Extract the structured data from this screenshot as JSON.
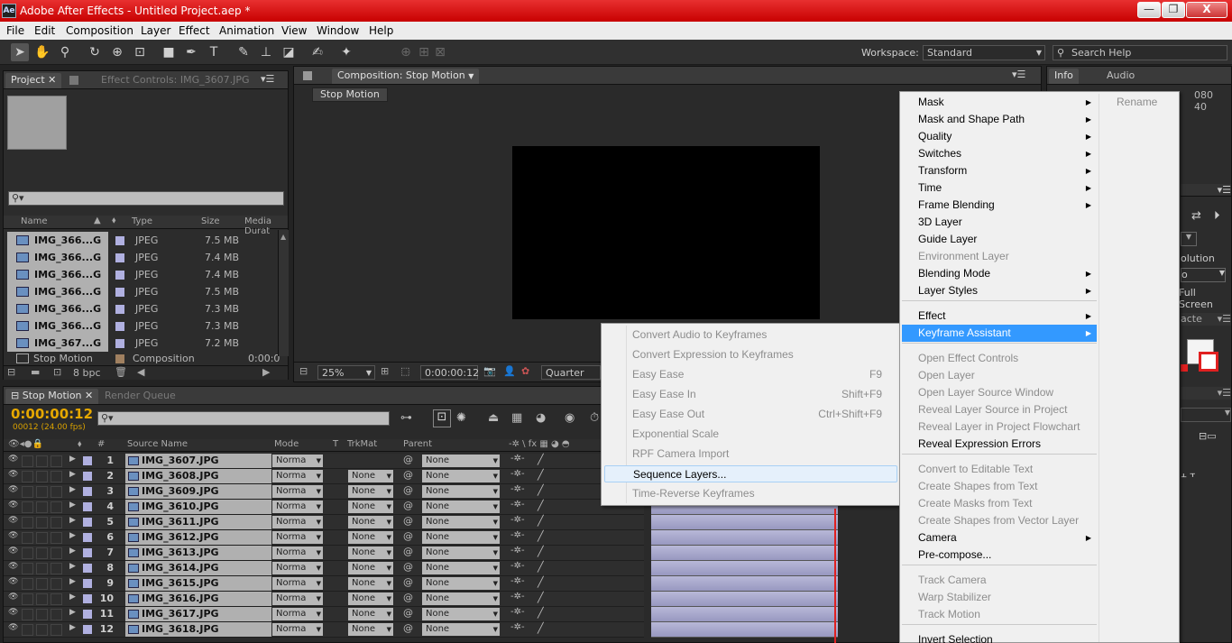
{
  "window": {
    "app_icon": "Ae",
    "title": "Adobe After Effects - Untitled Project.aep *",
    "minimize": "—",
    "maximize": "❐",
    "close": "X"
  },
  "menubar": [
    "File",
    "Edit",
    "Composition",
    "Layer",
    "Effect",
    "Animation",
    "View",
    "Window",
    "Help"
  ],
  "toolbar": {
    "workspace_label": "Workspace:",
    "workspace_value": "Standard",
    "search_placeholder": "Search Help"
  },
  "project_panel": {
    "tab_project": "Project",
    "tab_effect_controls": "Effect Controls: IMG_3607.JPG",
    "columns": {
      "name": "Name",
      "type": "Type",
      "size": "Size",
      "duration": "Media Durat"
    },
    "items": [
      {
        "name": "IMG_366...G",
        "type": "JPEG",
        "size": "7.5 MB"
      },
      {
        "name": "IMG_366...G",
        "type": "JPEG",
        "size": "7.4 MB"
      },
      {
        "name": "IMG_366...G",
        "type": "JPEG",
        "size": "7.4 MB"
      },
      {
        "name": "IMG_366...G",
        "type": "JPEG",
        "size": "7.5 MB"
      },
      {
        "name": "IMG_366...G",
        "type": "JPEG",
        "size": "7.3 MB"
      },
      {
        "name": "IMG_366...G",
        "type": "JPEG",
        "size": "7.3 MB"
      },
      {
        "name": "IMG_367...G",
        "type": "JPEG",
        "size": "7.2 MB"
      }
    ],
    "composition_item": {
      "name": "Stop Motion",
      "type": "Composition",
      "duration": "0:00:0"
    },
    "bpc": "8 bpc"
  },
  "composition_panel": {
    "tab": "Composition: Stop Motion",
    "breadcrumb": "Stop Motion",
    "zoom": "25%",
    "timecode": "0:00:00:12",
    "resolution": "Quarter"
  },
  "timeline": {
    "tab_active": "Stop Motion",
    "tab_render": "Render Queue",
    "timecode": "0:00:00:12",
    "fps": "00012 (24.00 fps)",
    "columns": {
      "num": "#",
      "source": "Source Name",
      "mode": "Mode",
      "t": "T",
      "trkmat": "TrkMat",
      "parent": "Parent"
    },
    "layers": [
      {
        "num": "1",
        "name": "IMG_3607.JPG",
        "mode": "Norma",
        "trk": "",
        "parent": "None"
      },
      {
        "num": "2",
        "name": "IMG_3608.JPG",
        "mode": "Norma",
        "trk": "None",
        "parent": "None"
      },
      {
        "num": "3",
        "name": "IMG_3609.JPG",
        "mode": "Norma",
        "trk": "None",
        "parent": "None"
      },
      {
        "num": "4",
        "name": "IMG_3610.JPG",
        "mode": "Norma",
        "trk": "None",
        "parent": "None"
      },
      {
        "num": "5",
        "name": "IMG_3611.JPG",
        "mode": "Norma",
        "trk": "None",
        "parent": "None"
      },
      {
        "num": "6",
        "name": "IMG_3612.JPG",
        "mode": "Norma",
        "trk": "None",
        "parent": "None"
      },
      {
        "num": "7",
        "name": "IMG_3613.JPG",
        "mode": "Norma",
        "trk": "None",
        "parent": "None"
      },
      {
        "num": "8",
        "name": "IMG_3614.JPG",
        "mode": "Norma",
        "trk": "None",
        "parent": "None"
      },
      {
        "num": "9",
        "name": "IMG_3615.JPG",
        "mode": "Norma",
        "trk": "None",
        "parent": "None"
      },
      {
        "num": "10",
        "name": "IMG_3616.JPG",
        "mode": "Norma",
        "trk": "None",
        "parent": "None"
      },
      {
        "num": "11",
        "name": "IMG_3617.JPG",
        "mode": "Norma",
        "trk": "None",
        "parent": "None"
      },
      {
        "num": "12",
        "name": "IMG_3618.JPG",
        "mode": "Norma",
        "trk": "None",
        "parent": "None"
      }
    ]
  },
  "right_panel": {
    "tab_info": "Info",
    "tab_audio": "Audio",
    "info_1": "080",
    "info_2": "40",
    "resolution_text": "olution",
    "full_screen": "Full Screen",
    "p_text": "o",
    "acte": "acte"
  },
  "context_menu": {
    "items": [
      {
        "label": "Mask",
        "submenu": true
      },
      {
        "label": "Mask and Shape Path",
        "submenu": true
      },
      {
        "label": "Quality",
        "submenu": true
      },
      {
        "label": "Switches",
        "submenu": true
      },
      {
        "label": "Transform",
        "submenu": true
      },
      {
        "label": "Time",
        "submenu": true
      },
      {
        "label": "Frame Blending",
        "submenu": true
      },
      {
        "label": "3D Layer"
      },
      {
        "label": "Guide Layer"
      },
      {
        "label": "Environment Layer",
        "disabled": true
      },
      {
        "label": "Blending Mode",
        "submenu": true
      },
      {
        "label": "Layer Styles",
        "submenu": true
      },
      {
        "label": "Effect",
        "submenu": true
      },
      {
        "label": "Keyframe Assistant",
        "submenu": true,
        "highlighted": true
      },
      {
        "label": "Open Effect Controls",
        "disabled": true
      },
      {
        "label": "Open Layer",
        "disabled": true
      },
      {
        "label": "Open Layer Source Window",
        "disabled": true
      },
      {
        "label": "Reveal Layer Source in Project",
        "disabled": true
      },
      {
        "label": "Reveal Layer in Project Flowchart",
        "disabled": true
      },
      {
        "label": "Reveal Expression Errors"
      },
      {
        "label": "Convert to Editable Text",
        "disabled": true
      },
      {
        "label": "Create Shapes from Text",
        "disabled": true
      },
      {
        "label": "Create Masks from Text",
        "disabled": true
      },
      {
        "label": "Create Shapes from Vector Layer",
        "disabled": true
      },
      {
        "label": "Camera",
        "submenu": true
      },
      {
        "label": "Pre-compose..."
      },
      {
        "label": "Track Camera",
        "disabled": true
      },
      {
        "label": "Warp Stabilizer",
        "disabled": true
      },
      {
        "label": "Track Motion",
        "disabled": true
      },
      {
        "label": "Invert Selection"
      }
    ],
    "rename": "Rename"
  },
  "keyframe_submenu": {
    "items": [
      {
        "label": "Convert Audio to Keyframes",
        "disabled": true,
        "shortcut": ""
      },
      {
        "label": "Convert Expression to Keyframes",
        "disabled": true,
        "shortcut": ""
      },
      {
        "label": "Easy Ease",
        "disabled": true,
        "shortcut": "F9"
      },
      {
        "label": "Easy Ease In",
        "disabled": true,
        "shortcut": "Shift+F9"
      },
      {
        "label": "Easy Ease Out",
        "disabled": true,
        "shortcut": "Ctrl+Shift+F9"
      },
      {
        "label": "Exponential Scale",
        "disabled": true,
        "shortcut": ""
      },
      {
        "label": "RPF Camera Import",
        "disabled": true,
        "shortcut": ""
      },
      {
        "label": "Sequence Layers...",
        "disabled": false,
        "hover": true,
        "shortcut": ""
      },
      {
        "label": "Time-Reverse Keyframes",
        "disabled": true,
        "shortcut": ""
      }
    ]
  },
  "colors": {
    "title_bar": "#d40000",
    "timecode": "#e6a800",
    "bar": "#a8a8d0",
    "menu_highlight": "#3399ff",
    "playhead": "#e02020"
  }
}
